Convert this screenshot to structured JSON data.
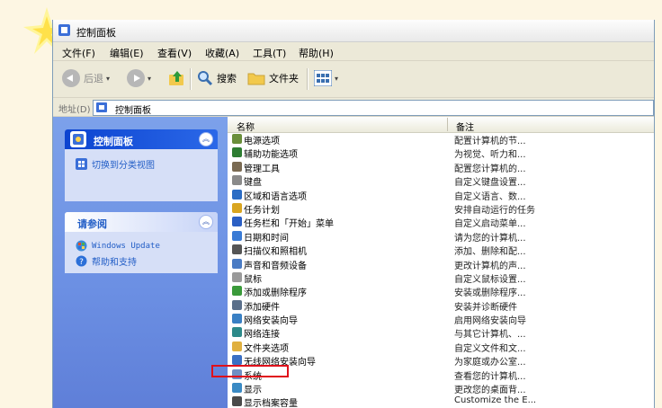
{
  "window": {
    "title": "控制面板"
  },
  "menu": [
    "文件(F)",
    "编辑(E)",
    "查看(V)",
    "收藏(A)",
    "工具(T)",
    "帮助(H)"
  ],
  "toolbar": {
    "back": "后退",
    "search": "搜索",
    "folders": "文件夹"
  },
  "address": {
    "label": "地址(D)",
    "value": "控制面板"
  },
  "sidebar": {
    "control_panel": {
      "title": "控制面板",
      "link": "切换到分类视图"
    },
    "see_also": {
      "title": "请参阅",
      "links": [
        "Windows Update",
        "帮助和支持"
      ]
    }
  },
  "list": {
    "columns": {
      "name": "名称",
      "comment": "备注"
    },
    "items": [
      {
        "name": "电源选项",
        "desc": "配置计算机的节...",
        "icon_color": "#6a8f3a"
      },
      {
        "name": "辅助功能选项",
        "desc": "为视觉、听力和...",
        "icon_color": "#2e7d32"
      },
      {
        "name": "管理工具",
        "desc": "配置您计算机的...",
        "icon_color": "#7a6a52"
      },
      {
        "name": "键盘",
        "desc": "自定义键盘设置...",
        "icon_color": "#8a8a8a"
      },
      {
        "name": "区域和语言选项",
        "desc": "自定义语言、数...",
        "icon_color": "#2b6cc4"
      },
      {
        "name": "任务计划",
        "desc": "安排自动运行的任务",
        "icon_color": "#d9a520"
      },
      {
        "name": "任务栏和「开始」菜单",
        "desc": "自定义启动菜单...",
        "icon_color": "#2b5fc4"
      },
      {
        "name": "日期和时间",
        "desc": "请为您的计算机...",
        "icon_color": "#3a7bd5"
      },
      {
        "name": "扫描仪和照相机",
        "desc": "添加、删除和配...",
        "icon_color": "#555555"
      },
      {
        "name": "声音和音频设备",
        "desc": "更改计算机的声...",
        "icon_color": "#4a7bc4"
      },
      {
        "name": "鼠标",
        "desc": "自定义鼠标设置...",
        "icon_color": "#9a9a9a"
      },
      {
        "name": "添加或删除程序",
        "desc": "安装或删除程序...",
        "icon_color": "#3a9a3a"
      },
      {
        "name": "添加硬件",
        "desc": "安装并诊断硬件",
        "icon_color": "#5a6f8a"
      },
      {
        "name": "网络安装向导",
        "desc": "启用网络安装向导",
        "icon_color": "#3a80c4"
      },
      {
        "name": "网络连接",
        "desc": "与其它计算机、...",
        "icon_color": "#2d8a8a"
      },
      {
        "name": "文件夹选项",
        "desc": "自定义文件和文...",
        "icon_color": "#e0b040"
      },
      {
        "name": "无线网络安装向导",
        "desc": "为家庭或办公室...",
        "icon_color": "#3a6fc4"
      },
      {
        "name": "系统",
        "desc": "查看您的计算机...",
        "icon_color": "#6f8fc4"
      },
      {
        "name": "显示",
        "desc": "更改您的桌面背...",
        "icon_color": "#3a8ac4"
      },
      {
        "name": "显示档案容量",
        "desc": "Customize the E...",
        "icon_color": "#4a4a4a"
      }
    ]
  }
}
